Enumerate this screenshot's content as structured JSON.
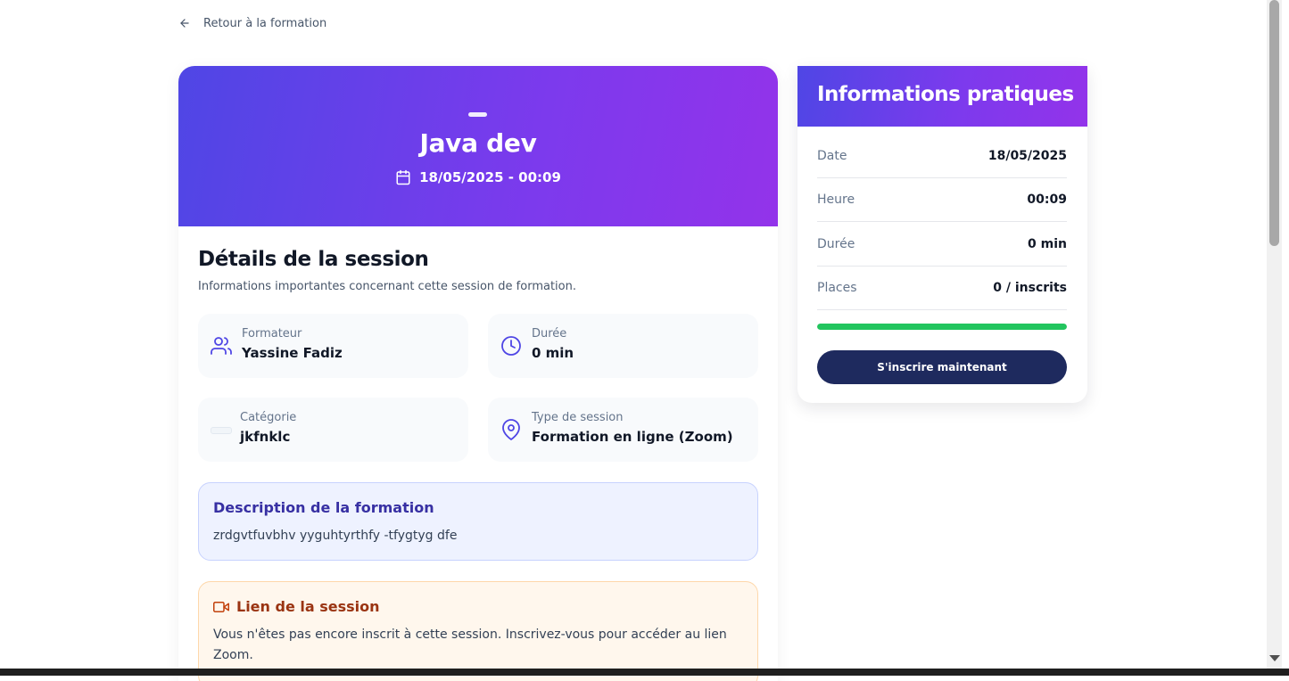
{
  "nav": {
    "back_label": "Retour à la formation"
  },
  "hero": {
    "title": "Java dev",
    "datetime": "18/05/2025 - 00:09"
  },
  "details": {
    "title": "Détails de la session",
    "subtitle": "Informations importantes concernant cette session de formation.",
    "formateur": {
      "label": "Formateur",
      "value": "Yassine Fadiz"
    },
    "duree": {
      "label": "Durée",
      "value": "0 min"
    },
    "categorie": {
      "label": "Catégorie",
      "value": "jkfnklc"
    },
    "type": {
      "label": "Type de session",
      "value": "Formation en ligne (Zoom)"
    }
  },
  "description": {
    "title": "Description de la formation",
    "text": "zrdgvtfuvbhv yyguhtyrthfy -tfygtyg dfe"
  },
  "session_link": {
    "title": "Lien de la session",
    "text": "Vous n'êtes pas encore inscrit à cette session. Inscrivez-vous pour accéder au lien Zoom."
  },
  "practical": {
    "title": "Informations pratiques",
    "rows": [
      {
        "label": "Date",
        "value": "18/05/2025"
      },
      {
        "label": "Heure",
        "value": "00:09"
      },
      {
        "label": "Durée",
        "value": "0 min"
      },
      {
        "label": "Places",
        "value": "0 / inscrits"
      }
    ],
    "fill_fraction": 1.0,
    "enroll_label": "S'inscrire maintenant"
  },
  "colors": {
    "gradient_start": "#4f46e5",
    "gradient_end": "#9333ea",
    "progress": "#22c55e",
    "button": "#1e2a5e",
    "icon_accent": "#4f46e5"
  },
  "icons": [
    "arrow-left-icon",
    "calendar-icon",
    "users-icon",
    "clock-icon",
    "map-pin-icon",
    "video-icon"
  ]
}
